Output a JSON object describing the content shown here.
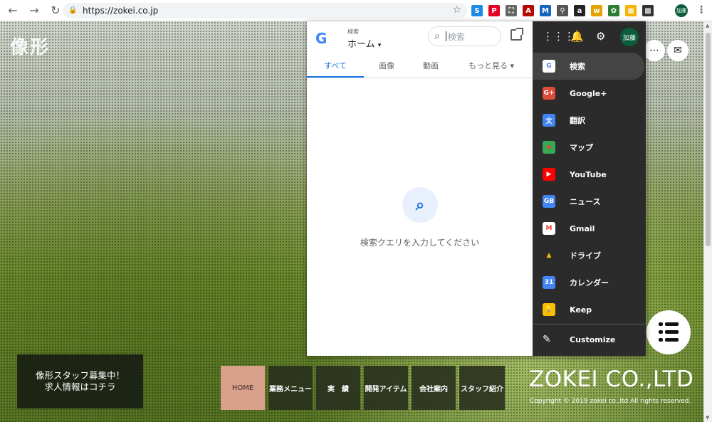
{
  "browser": {
    "url": "https://zokei.co.jp",
    "profile": "加藤",
    "extensions": [
      {
        "name": "extension-s-icon",
        "glyph": "S",
        "color": "#1e88e5"
      },
      {
        "name": "pinterest-icon",
        "glyph": "P",
        "color": "#e60023"
      },
      {
        "name": "screenshot-icon",
        "glyph": "⛶",
        "color": "#666666"
      },
      {
        "name": "acrobat-icon",
        "glyph": "A",
        "color": "#b30b00"
      },
      {
        "name": "extension-m-icon",
        "glyph": "M",
        "color": "#1565c0"
      },
      {
        "name": "pin-icon",
        "glyph": "⚲",
        "color": "#555555"
      },
      {
        "name": "amazon-icon",
        "glyph": "a",
        "color": "#222222"
      },
      {
        "name": "extension-w-icon",
        "glyph": "w",
        "color": "#e6a200"
      },
      {
        "name": "settings-ext-icon",
        "glyph": "✿",
        "color": "#2e7d32"
      },
      {
        "name": "google-bar-icon",
        "glyph": "▦",
        "color": "#f4b400"
      },
      {
        "name": "qr-icon",
        "glyph": "▩",
        "color": "#333333"
      }
    ]
  },
  "site": {
    "logo_text": "像形",
    "recruit_line1": "像形スタッフ募集中！",
    "recruit_line2": "求人情報はコチラ",
    "nav": [
      {
        "label": "HOME",
        "active": true
      },
      {
        "label": "業務メニュー",
        "active": false
      },
      {
        "label": "実　績",
        "active": false
      },
      {
        "label": "開発アイテム",
        "active": false
      },
      {
        "label": "会社案内",
        "active": false
      },
      {
        "label": "スタッフ紹介",
        "active": false
      }
    ],
    "company": "ZOKEI CO.,LTD",
    "copyright": "Copyright © 2019 zokei co.,ltd All rights reserved."
  },
  "popup": {
    "label_small": "検索",
    "section": "ホーム",
    "search_placeholder": "検索",
    "tabs": [
      {
        "label": "すべて",
        "active": true
      },
      {
        "label": "画像",
        "active": false
      },
      {
        "label": "動画",
        "active": false
      },
      {
        "label": "もっと見る ▾",
        "active": false
      }
    ],
    "empty_message": "検索クエリを入力してください",
    "avatar": "加藤",
    "apps": [
      {
        "label": "検索",
        "icon": "google-icon",
        "glyph": "G",
        "color": "#ffffff",
        "fg": "#4285f4",
        "active": true
      },
      {
        "label": "Google+",
        "icon": "google-plus-icon",
        "glyph": "G+",
        "color": "#dd4b39",
        "fg": "#ffffff",
        "active": false
      },
      {
        "label": "翻訳",
        "icon": "translate-icon",
        "glyph": "文",
        "color": "#4285f4",
        "fg": "#ffffff",
        "active": false
      },
      {
        "label": "マップ",
        "icon": "maps-icon",
        "glyph": "◆",
        "color": "#34a853",
        "fg": "#ea4335",
        "active": false
      },
      {
        "label": "YouTube",
        "icon": "youtube-icon",
        "glyph": "▶",
        "color": "#ff0000",
        "fg": "#ffffff",
        "active": false
      },
      {
        "label": "ニュース",
        "icon": "news-icon",
        "glyph": "GB",
        "color": "#4285f4",
        "fg": "#ffffff",
        "active": false
      },
      {
        "label": "Gmail",
        "icon": "gmail-icon",
        "glyph": "M",
        "color": "#ffffff",
        "fg": "#ea4335",
        "active": false
      },
      {
        "label": "ドライブ",
        "icon": "drive-icon",
        "glyph": "▲",
        "color": "#2b2b2b",
        "fg": "#fbbc04",
        "active": false
      },
      {
        "label": "カレンダー",
        "icon": "calendar-icon",
        "glyph": "31",
        "color": "#4285f4",
        "fg": "#ffffff",
        "active": false
      },
      {
        "label": "Keep",
        "icon": "keep-icon",
        "glyph": "💡",
        "color": "#fbbc04",
        "fg": "#ffffff",
        "active": false
      }
    ],
    "customize": "Customize"
  }
}
